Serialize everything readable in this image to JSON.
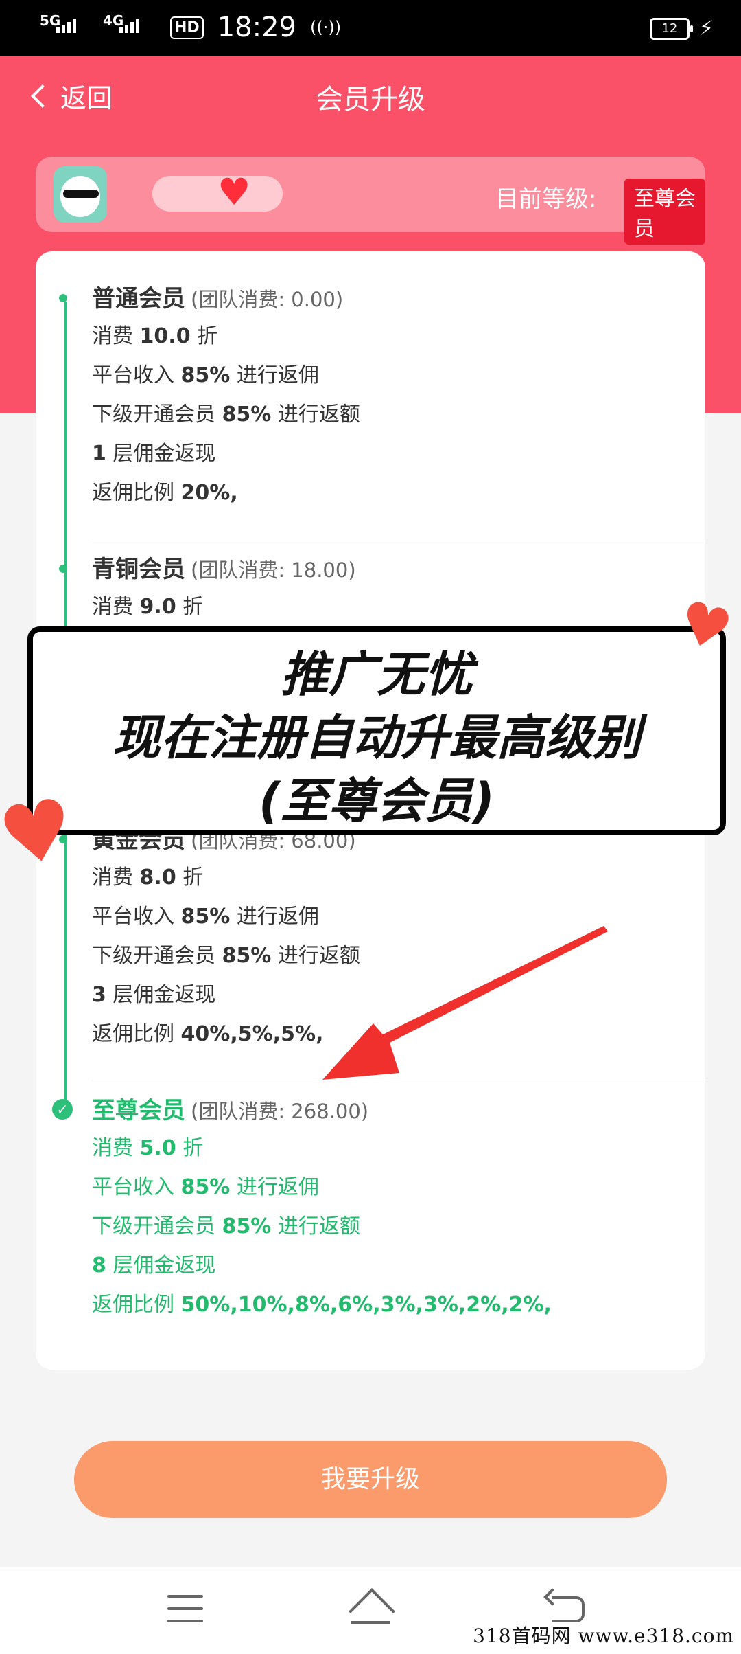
{
  "status_bar": {
    "network1": "5G",
    "network2": "4G",
    "hd": "HD",
    "time": "18:29",
    "battery": "12"
  },
  "header": {
    "back_label": "返回",
    "title": "会员升级"
  },
  "user": {
    "level_label": "目前等级:",
    "level_badge": "至尊会员"
  },
  "tiers": [
    {
      "name": "普通会员",
      "spend": "(团队消费: 0.00)",
      "lines": [
        {
          "pre": "消费 ",
          "strong": "10.0",
          "post": " 折"
        },
        {
          "pre": "平台收入 ",
          "strong": "85%",
          "post": " 进行返佣"
        },
        {
          "pre": "下级开通会员 ",
          "strong": "85%",
          "post": " 进行返额"
        },
        {
          "pre": "",
          "strong": "1",
          "post": " 层佣金返现"
        },
        {
          "pre": "返佣比例 ",
          "strong": "20%,",
          "post": ""
        }
      ]
    },
    {
      "name": "青铜会员",
      "spend": "(团队消费: 18.00)",
      "lines": [
        {
          "pre": "消费 ",
          "strong": "9.0",
          "post": " 折"
        }
      ]
    },
    {
      "name": "黄金会员",
      "spend": "(团队消费: 68.00)",
      "lines": [
        {
          "pre": "消费 ",
          "strong": "8.0",
          "post": " 折"
        },
        {
          "pre": "平台收入 ",
          "strong": "85%",
          "post": " 进行返佣"
        },
        {
          "pre": "下级开通会员 ",
          "strong": "85%",
          "post": " 进行返额"
        },
        {
          "pre": "",
          "strong": "3",
          "post": " 层佣金返现"
        },
        {
          "pre": "返佣比例 ",
          "strong": "40%,5%,5%,",
          "post": ""
        }
      ]
    },
    {
      "name": "至尊会员",
      "spend": "(团队消费: 268.00)",
      "lines": [
        {
          "pre": "消费 ",
          "strong": "5.0",
          "post": " 折"
        },
        {
          "pre": "平台收入 ",
          "strong": "85%",
          "post": " 进行返佣"
        },
        {
          "pre": "下级开通会员 ",
          "strong": "85%",
          "post": " 进行返额"
        },
        {
          "pre": "",
          "strong": "8",
          "post": " 层佣金返现"
        },
        {
          "pre": "返佣比例 ",
          "strong": "50%,10%,8%,6%,3%,3%,2%,2%,",
          "post": ""
        }
      ]
    }
  ],
  "upgrade_button": "我要升级",
  "overlay": {
    "line1": "推广无忧",
    "line2": "现在注册自动升最高级别",
    "line3": "(至尊会员)"
  },
  "watermark": "318首码网  www.e318.com",
  "colors": {
    "accent": "#fb5168",
    "active": "#22bb6e",
    "button": "#fb9a6a",
    "badge": "#e6182f"
  }
}
